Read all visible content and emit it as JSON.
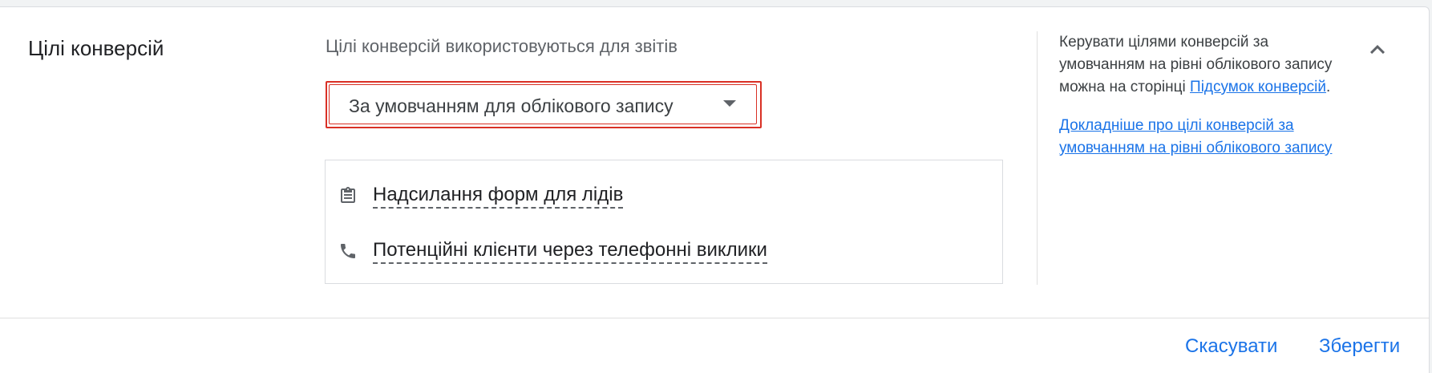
{
  "section": {
    "title": "Цілі конверсій",
    "subtitle": "Цілі конверсій використовуються для звітів"
  },
  "dropdown": {
    "selected": "За умовчанням для облікового запису",
    "icon": "arrow-drop-down-icon"
  },
  "goals": [
    {
      "icon": "clipboard-icon",
      "label": "Надсилання форм для лідів"
    },
    {
      "icon": "phone-icon",
      "label": "Потенційні клієнти через телефонні виклики"
    }
  ],
  "help": {
    "text_before_link": "Керувати цілями конверсій за умовчанням на рівні облікового запису можна на сторінці ",
    "link_summary": "Підсумок конверсій",
    "text_after_link": ".",
    "link_learn_more": "Докладніше про цілі конверсій за умовчанням на рівні облікового запису"
  },
  "footer": {
    "cancel_label": "Скасувати",
    "save_label": "Зберегти"
  },
  "colors": {
    "accent": "#1a73e8",
    "highlight": "#d93025"
  }
}
